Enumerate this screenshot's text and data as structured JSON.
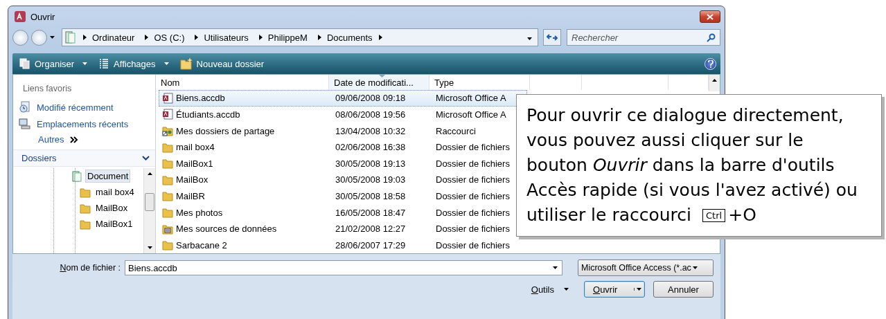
{
  "window": {
    "title": "Ouvrir"
  },
  "breadcrumb": [
    "Ordinateur",
    "OS (C:)",
    "Utilisateurs",
    "PhilippeM",
    "Documents"
  ],
  "search": {
    "placeholder": "Rechercher"
  },
  "toolbar": [
    {
      "label": "Organiser",
      "kind": "organize",
      "dropdown": true
    },
    {
      "label": "Affichages",
      "kind": "views",
      "dropdown": true
    },
    {
      "label": "Nouveau dossier",
      "kind": "newfolder",
      "dropdown": false
    }
  ],
  "sidebar": {
    "favorites_title": "Liens favoris",
    "favorites": [
      {
        "label": "Modifié récemment",
        "kind": "recent"
      },
      {
        "label": "Emplacements récents",
        "kind": "places"
      }
    ],
    "more": "Autres",
    "folders_title": "Dossiers",
    "tree": [
      {
        "label": "Document",
        "kind": "library",
        "selected": true,
        "children": [
          {
            "label": "mail box4",
            "kind": "folder",
            "selected": false
          },
          {
            "label": "MailBox",
            "kind": "folder",
            "selected": false
          },
          {
            "label": "MailBox1",
            "kind": "folder",
            "selected": false
          }
        ]
      }
    ]
  },
  "table": {
    "columns": [
      {
        "label": "Nom",
        "sorted": false
      },
      {
        "label": "Date de modificati...",
        "sorted": true
      },
      {
        "label": "Type",
        "sorted": false
      }
    ],
    "rows": [
      {
        "name": "Biens.accdb",
        "date": "09/06/2008 09:18",
        "type": "Microsoft Office A",
        "kind": "access",
        "selected": true
      },
      {
        "name": "Étudiants.accdb",
        "date": "08/06/2008 19:56",
        "type": "Microsoft Office A",
        "kind": "access",
        "selected": false
      },
      {
        "name": "Mes dossiers de partage",
        "date": "13/04/2008 10:32",
        "type": "Raccourci",
        "kind": "shortcut",
        "selected": false
      },
      {
        "name": "mail box4",
        "date": "02/06/2008 16:38",
        "type": "Dossier de fichiers",
        "kind": "folder",
        "selected": false
      },
      {
        "name": "MailBox1",
        "date": "30/05/2008 19:13",
        "type": "Dossier de fichiers",
        "kind": "folder",
        "selected": false
      },
      {
        "name": "MailBox",
        "date": "30/05/2008 19:03",
        "type": "Dossier de fichiers",
        "kind": "folder",
        "selected": false
      },
      {
        "name": "MailBR",
        "date": "30/05/2008 18:58",
        "type": "Dossier de fichiers",
        "kind": "folder",
        "selected": false
      },
      {
        "name": "Mes photos",
        "date": "16/05/2008 18:47",
        "type": "Dossier de fichiers",
        "kind": "folder",
        "selected": false
      },
      {
        "name": "Mes sources de données",
        "date": "21/02/2008 12:27",
        "type": "Dossier de fichiers",
        "kind": "datasource",
        "selected": false
      },
      {
        "name": "Sarbacane 2",
        "date": "28/06/2007 17:29",
        "type": "Dossier de fichiers",
        "kind": "folder",
        "selected": false
      }
    ]
  },
  "footer": {
    "file_name_label": "Nom de fichier :",
    "file_name": "Biens.accdb",
    "file_type": "Microsoft Office Access (*.ac",
    "tools": "Outils",
    "open": "Ouvrir",
    "cancel": "Annuler"
  },
  "callout": {
    "text": "Pour ouvrir ce dialogue directement, vous pouvez aussi cliquer sur le bouton *Ouvrir* dans la barre d'outils Accès rapide (si vous l'avez activé) ou",
    "shortcut_text": "utiliser le raccourci",
    "key": "Ctrl",
    "suffix": "+O"
  }
}
